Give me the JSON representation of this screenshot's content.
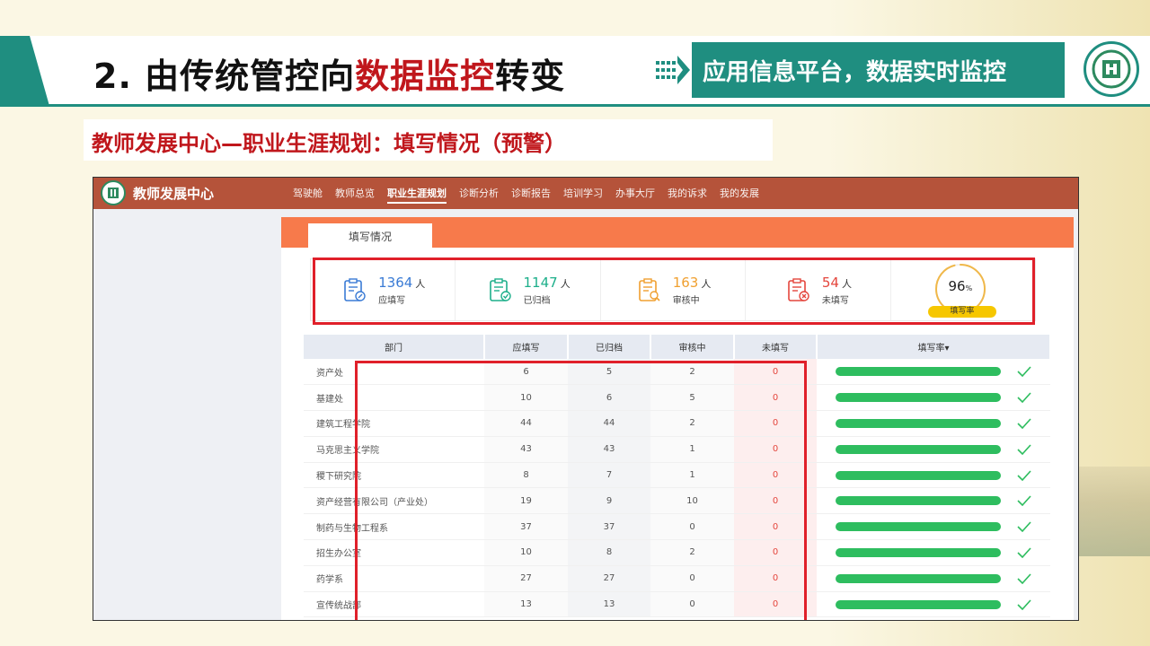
{
  "slide": {
    "title_prefix": "2. 由传统管控向",
    "title_highlight": "数据监控",
    "title_suffix": "转变",
    "platform_label": "应用信息平台，数据实时监控",
    "subtitle": "教师发展中心—职业生涯规划：填写情况（预警）",
    "colors": {
      "teal": "#1f8e80",
      "red": "#c0171c"
    }
  },
  "app": {
    "brand": "教师发展中心",
    "nav": [
      "驾驶舱",
      "教师总览",
      "职业生涯规划",
      "诊断分析",
      "诊断报告",
      "培训学习",
      "办事大厅",
      "我的诉求",
      "我的发展"
    ],
    "active_nav": "职业生涯规划",
    "tab": "填写情况",
    "stats": [
      {
        "value": "1364",
        "unit": "人",
        "label": "应填写",
        "color": "#3a7bd5",
        "icon": "clipboard-edit-icon"
      },
      {
        "value": "1147",
        "unit": "人",
        "label": "已归档",
        "color": "#1daf8a",
        "icon": "clipboard-check-icon"
      },
      {
        "value": "163",
        "unit": "人",
        "label": "审核中",
        "color": "#f0a030",
        "icon": "clipboard-search-icon"
      },
      {
        "value": "54",
        "unit": "人",
        "label": "未填写",
        "color": "#e4463d",
        "icon": "clipboard-x-icon"
      }
    ],
    "rate": {
      "value": "96",
      "unit": "%",
      "label": "填写率",
      "fraction": 0.96
    },
    "table": {
      "headers": [
        "部门",
        "应填写",
        "已归档",
        "审核中",
        "未填写",
        "填写率▾"
      ],
      "rows": [
        {
          "dept": "资产处",
          "should": "6",
          "archived": "5",
          "review": "2",
          "missing": "0",
          "rate": 1.0
        },
        {
          "dept": "基建处",
          "should": "10",
          "archived": "6",
          "review": "5",
          "missing": "0",
          "rate": 1.0
        },
        {
          "dept": "建筑工程学院",
          "should": "44",
          "archived": "44",
          "review": "2",
          "missing": "0",
          "rate": 1.0
        },
        {
          "dept": "马克思主义学院",
          "should": "43",
          "archived": "43",
          "review": "1",
          "missing": "0",
          "rate": 1.0
        },
        {
          "dept": "稷下研究院",
          "should": "8",
          "archived": "7",
          "review": "1",
          "missing": "0",
          "rate": 1.0
        },
        {
          "dept": "资产经营有限公司（产业处）",
          "should": "19",
          "archived": "9",
          "review": "10",
          "missing": "0",
          "rate": 1.0
        },
        {
          "dept": "制药与生物工程系",
          "should": "37",
          "archived": "37",
          "review": "0",
          "missing": "0",
          "rate": 1.0
        },
        {
          "dept": "招生办公室",
          "should": "10",
          "archived": "8",
          "review": "2",
          "missing": "0",
          "rate": 1.0
        },
        {
          "dept": "药学系",
          "should": "27",
          "archived": "27",
          "review": "0",
          "missing": "0",
          "rate": 1.0
        },
        {
          "dept": "宣传统战部",
          "should": "13",
          "archived": "13",
          "review": "0",
          "missing": "0",
          "rate": 1.0
        }
      ]
    }
  }
}
